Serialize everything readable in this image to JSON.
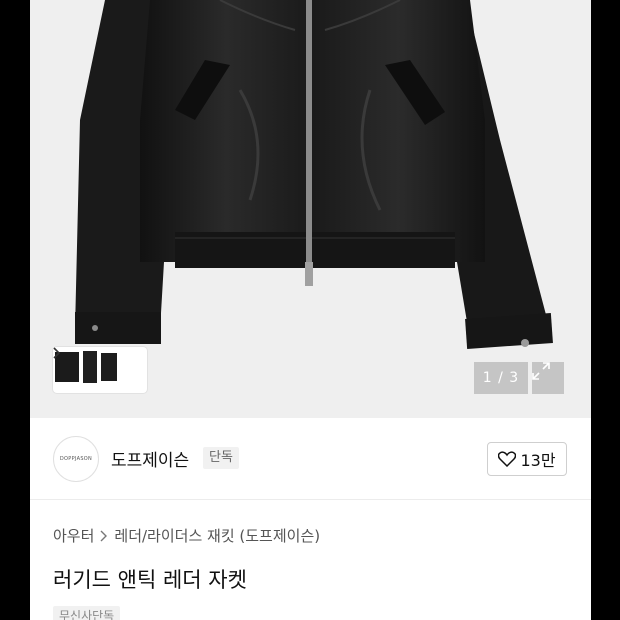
{
  "gallery": {
    "counter": "1 / 3",
    "current_index": 1,
    "total": 3
  },
  "brand": {
    "logo_text": "DOPPJASON",
    "name": "도프제이슨",
    "badge": "단독"
  },
  "like": {
    "count": "13만"
  },
  "breadcrumb": {
    "category": "아우터",
    "subcategory": "레더/라이더스 재킷 (도프제이슨)"
  },
  "product": {
    "title": "러기드 앤틱 레더 자켓",
    "tag": "무신사단독"
  },
  "colors": {
    "jacket": "#1b1b1b",
    "hero_bg": "#efefef",
    "text": "#111111"
  }
}
